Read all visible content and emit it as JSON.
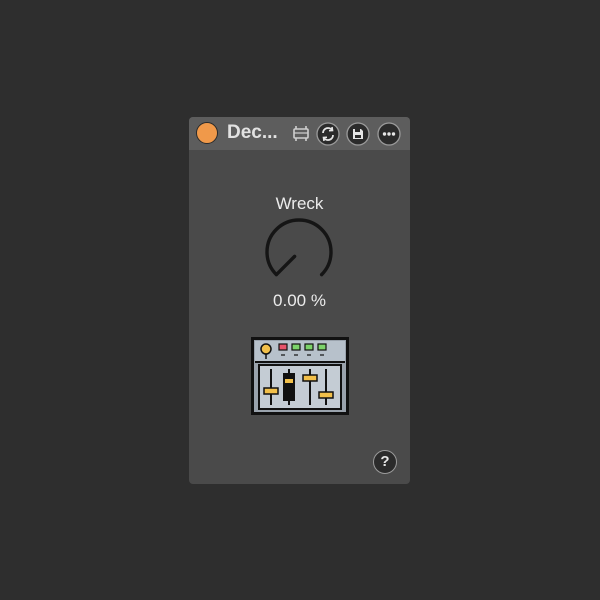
{
  "device": {
    "title": "Dec...",
    "power_on": true,
    "parameter": {
      "label": "Wreck",
      "value": "0.00 %",
      "level": 0.0
    },
    "help_label": "?"
  },
  "icons": {
    "power": "power-toggle-icon",
    "mapping": "keyboard-mapping-icon",
    "hot_swap": "hot-swap-icon",
    "save": "save-preset-icon",
    "more": "more-options-icon",
    "mixer": "mixer-console-icon"
  },
  "colors": {
    "background": "#2e2e2e",
    "panel": "#4a4a4a",
    "titlebar": "#5d5d5d",
    "power_accent": "#f0994a",
    "text": "#ececec"
  }
}
